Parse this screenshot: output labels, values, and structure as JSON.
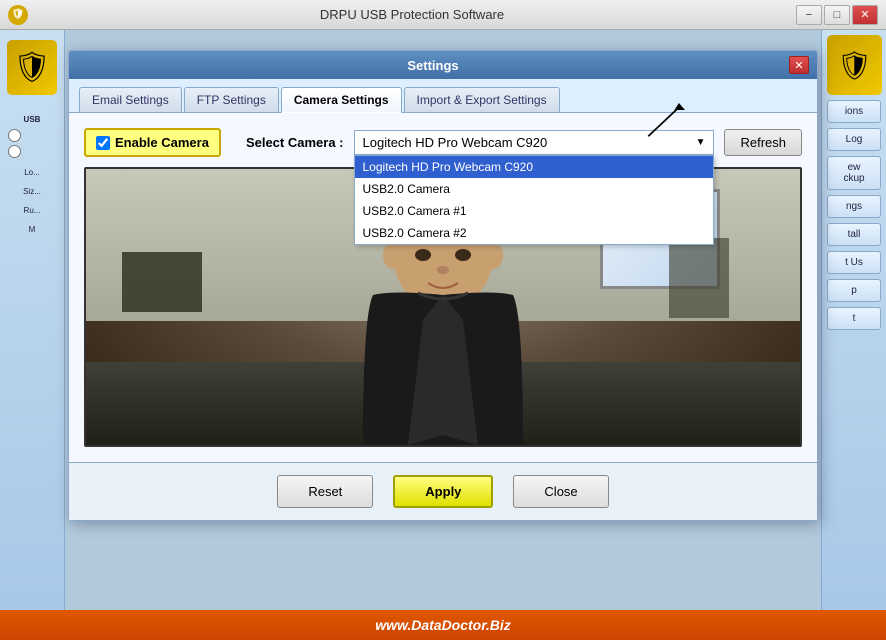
{
  "app": {
    "title": "DRPU USB Protection Software",
    "icon": "🛡"
  },
  "title_bar": {
    "minimize_label": "−",
    "maximize_label": "□",
    "close_label": "✕"
  },
  "dialog": {
    "title": "Settings",
    "close_label": "✕"
  },
  "tabs": [
    {
      "id": "email",
      "label": "Email Settings",
      "active": false
    },
    {
      "id": "ftp",
      "label": "FTP Settings",
      "active": false
    },
    {
      "id": "camera",
      "label": "Camera Settings",
      "active": true
    },
    {
      "id": "import_export",
      "label": "Import & Export Settings",
      "active": false
    }
  ],
  "camera_settings": {
    "enable_label": "Enable Camera",
    "select_label": "Select Camera :",
    "selected_camera": "Logitech HD Pro Webcam C920",
    "cameras": [
      {
        "label": "Logitech HD Pro Webcam C920",
        "selected": true
      },
      {
        "label": "USB2.0 Camera",
        "selected": false
      },
      {
        "label": "USB2.0 Camera #1",
        "selected": false
      },
      {
        "label": "USB2.0 Camera #2",
        "selected": false
      }
    ],
    "refresh_label": "Refresh"
  },
  "footer": {
    "reset_label": "Reset",
    "apply_label": "Apply",
    "close_label": "Close"
  },
  "right_sidebar": {
    "buttons": [
      {
        "label": "ions"
      },
      {
        "label": "Log"
      },
      {
        "label": "ew\nckup"
      },
      {
        "label": "ngs"
      },
      {
        "label": "tall"
      },
      {
        "label": "t Us"
      },
      {
        "label": "p"
      },
      {
        "label": "t"
      }
    ]
  },
  "sidebar": {
    "usb_label": "USB",
    "log_size_label": "Log\nSize"
  },
  "bottom_bar": {
    "text": "www.DataDoctor.Biz"
  }
}
